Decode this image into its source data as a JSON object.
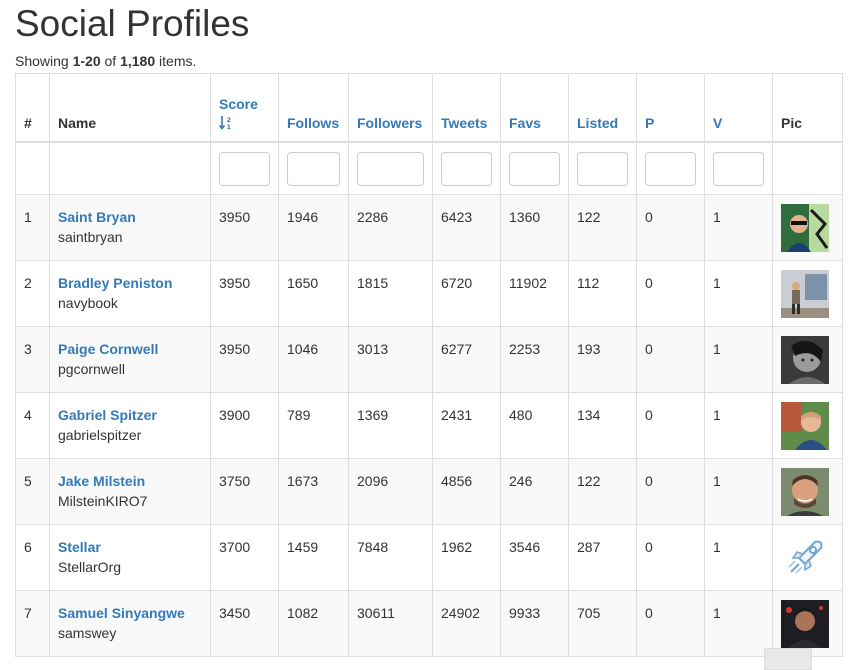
{
  "page": {
    "title": "Social Profiles",
    "summary_prefix": "Showing ",
    "summary_range": "1-20",
    "summary_of": " of ",
    "summary_total": "1,180",
    "summary_suffix": " items."
  },
  "table": {
    "headers": {
      "num": "#",
      "name": "Name",
      "score": "Score",
      "follows": "Follows",
      "followers": "Followers",
      "tweets": "Tweets",
      "favs": "Favs",
      "listed": "Listed",
      "p": "P",
      "v": "V",
      "pic": "Pic"
    },
    "rows": [
      {
        "num": "1",
        "name": "Saint Bryan",
        "handle": "saintbryan",
        "score": "3950",
        "follows": "1946",
        "followers": "2286",
        "tweets": "6423",
        "favs": "1360",
        "listed": "122",
        "p": "0",
        "v": "1",
        "pic": "avatar-saintbryan"
      },
      {
        "num": "2",
        "name": "Bradley Peniston",
        "handle": "navybook",
        "score": "3950",
        "follows": "1650",
        "followers": "1815",
        "tweets": "6720",
        "favs": "11902",
        "listed": "112",
        "p": "0",
        "v": "1",
        "pic": "avatar-navybook"
      },
      {
        "num": "3",
        "name": "Paige Cornwell",
        "handle": "pgcornwell",
        "score": "3950",
        "follows": "1046",
        "followers": "3013",
        "tweets": "6277",
        "favs": "2253",
        "listed": "193",
        "p": "0",
        "v": "1",
        "pic": "avatar-pgcornwell"
      },
      {
        "num": "4",
        "name": "Gabriel Spitzer",
        "handle": "gabrielspitzer",
        "score": "3900",
        "follows": "789",
        "followers": "1369",
        "tweets": "2431",
        "favs": "480",
        "listed": "134",
        "p": "0",
        "v": "1",
        "pic": "avatar-gabrielspitzer"
      },
      {
        "num": "5",
        "name": "Jake Milstein",
        "handle": "MilsteinKIRO7",
        "score": "3750",
        "follows": "1673",
        "followers": "2096",
        "tweets": "4856",
        "favs": "246",
        "listed": "122",
        "p": "0",
        "v": "1",
        "pic": "avatar-milstein"
      },
      {
        "num": "6",
        "name": "Stellar",
        "handle": "StellarOrg",
        "score": "3700",
        "follows": "1459",
        "followers": "7848",
        "tweets": "1962",
        "favs": "3546",
        "listed": "287",
        "p": "0",
        "v": "1",
        "pic": "rocket-logo"
      },
      {
        "num": "7",
        "name": "Samuel Sinyangwe",
        "handle": "samswey",
        "score": "3450",
        "follows": "1082",
        "followers": "30611",
        "tweets": "24902",
        "favs": "9933",
        "listed": "705",
        "p": "0",
        "v": "1",
        "pic": "avatar-samswey"
      }
    ]
  },
  "colors": {
    "link": "#337ab7",
    "text": "#333333",
    "border": "#dddddd",
    "stripe": "#f9f9f9"
  }
}
